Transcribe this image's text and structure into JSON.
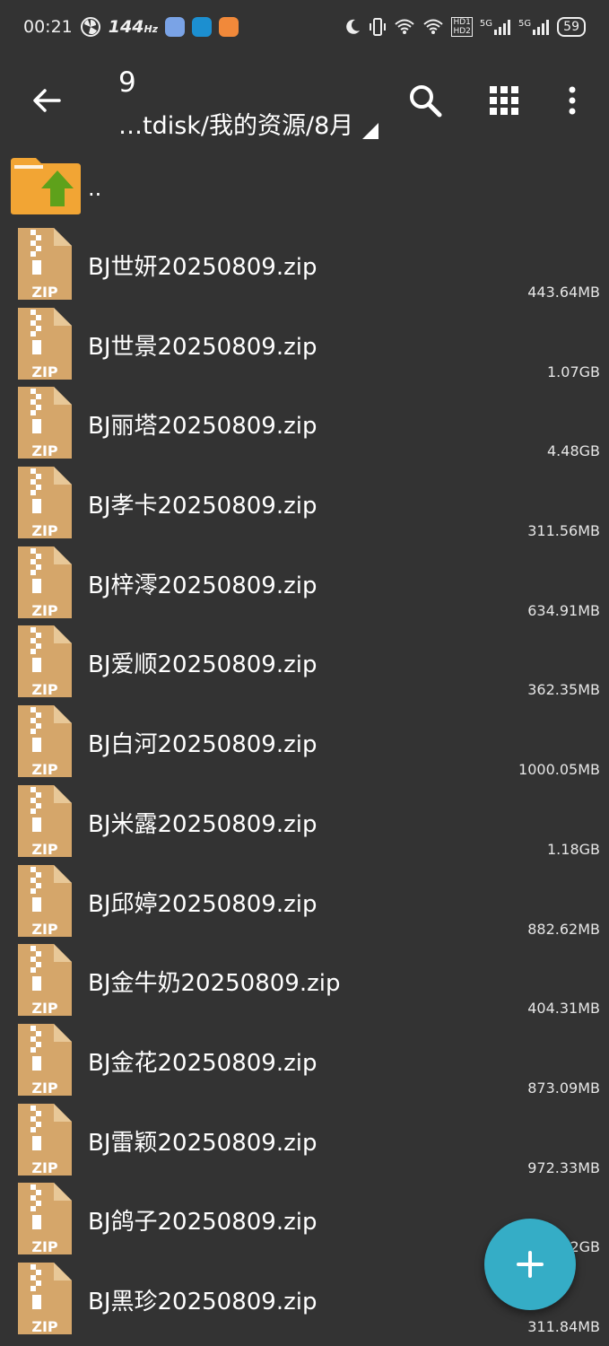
{
  "status": {
    "time": "00:21",
    "refresh": "144",
    "refresh_unit": "Hz",
    "network_5g_1": "5G",
    "network_5g_2": "5G",
    "hd1": "HD1",
    "hd2": "HD2",
    "battery": "59"
  },
  "toolbar": {
    "title": "9",
    "path": "…tdisk/我的资源/8月"
  },
  "up_label": "..",
  "icons": {
    "back": "back-arrow-icon",
    "search": "search-icon",
    "grid": "grid-view-icon",
    "more": "more-vert-icon",
    "zip_label": "ZIP",
    "fab": "add-icon"
  },
  "colors": {
    "background": "#333333",
    "zip_icon": "#d5a66a",
    "folder": "#f2a534",
    "arrow": "#5ea11b",
    "fab": "#35adc6"
  },
  "files": [
    {
      "name": "BJ世妍20250809.zip",
      "size": "443.64MB"
    },
    {
      "name": "BJ世景20250809.zip",
      "size": "1.07GB"
    },
    {
      "name": "BJ丽塔20250809.zip",
      "size": "4.48GB"
    },
    {
      "name": "BJ孝卡20250809.zip",
      "size": "311.56MB"
    },
    {
      "name": "BJ梓澪20250809.zip",
      "size": "634.91MB"
    },
    {
      "name": "BJ爱顺20250809.zip",
      "size": "362.35MB"
    },
    {
      "name": "BJ白河20250809.zip",
      "size": "1000.05MB"
    },
    {
      "name": "BJ米露20250809.zip",
      "size": "1.18GB"
    },
    {
      "name": "BJ邱婷20250809.zip",
      "size": "882.62MB"
    },
    {
      "name": "BJ金牛奶20250809.zip",
      "size": "404.31MB"
    },
    {
      "name": "BJ金花20250809.zip",
      "size": "873.09MB"
    },
    {
      "name": "BJ雷颖20250809.zip",
      "size": "972.33MB"
    },
    {
      "name": "BJ鸽子20250809.zip",
      "size": "2GB"
    },
    {
      "name": "BJ黑珍20250809.zip",
      "size": "311.84MB"
    }
  ]
}
